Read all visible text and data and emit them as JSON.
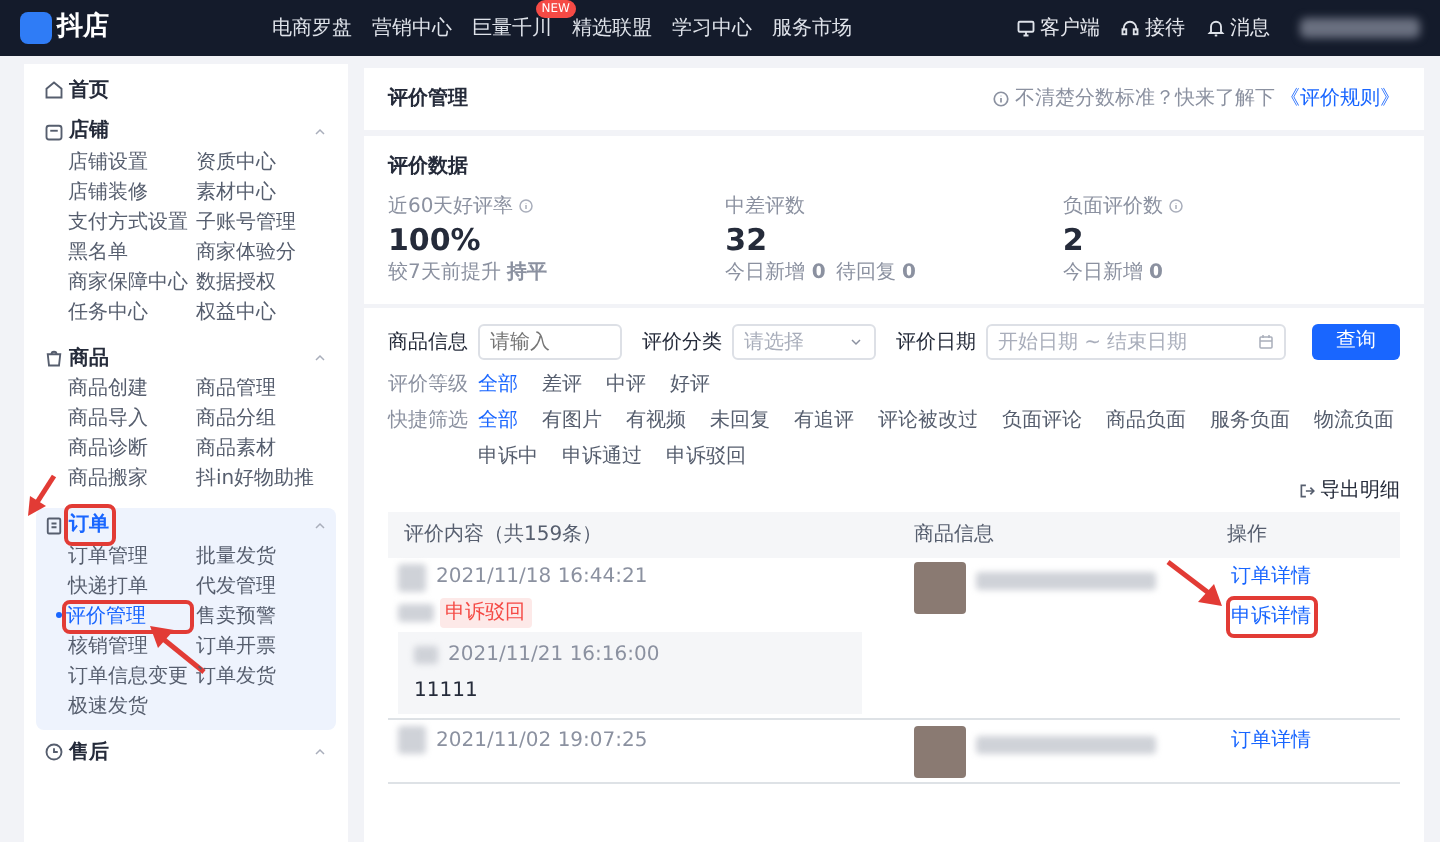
{
  "topbar": {
    "logo": "抖店",
    "nav": [
      {
        "label": "电商罗盘"
      },
      {
        "label": "营销中心"
      },
      {
        "label": "巨量千川",
        "badge": "NEW"
      },
      {
        "label": "精选联盟"
      },
      {
        "label": "学习中心"
      },
      {
        "label": "服务市场"
      }
    ],
    "tools": [
      {
        "kind": "desktop",
        "label": "客户端"
      },
      {
        "kind": "headset",
        "label": "接待"
      },
      {
        "kind": "bell",
        "label": "消息"
      }
    ]
  },
  "sidebar": {
    "items": [
      {
        "kind": "home",
        "label": "首页"
      },
      {
        "kind": "shop",
        "label": "店铺",
        "expanded": true,
        "children": [
          {
            "label": "店铺设置",
            "selected": false
          },
          {
            "label": "资质中心",
            "selected": false
          },
          {
            "label": "店铺装修",
            "selected": false
          },
          {
            "label": "素材中心",
            "selected": false
          },
          {
            "label": "支付方式设置",
            "selected": false
          },
          {
            "label": "子账号管理",
            "selected": false
          },
          {
            "label": "黑名单",
            "selected": false
          },
          {
            "label": "商家体验分",
            "selected": false
          },
          {
            "label": "商家保障中心",
            "selected": false
          },
          {
            "label": "数据授权",
            "selected": false
          },
          {
            "label": "任务中心",
            "selected": false
          },
          {
            "label": "权益中心",
            "selected": false
          }
        ]
      },
      {
        "kind": "goods",
        "label": "商品",
        "expanded": true,
        "children": [
          {
            "label": "商品创建",
            "selected": false
          },
          {
            "label": "商品管理",
            "selected": false
          },
          {
            "label": "商品导入",
            "selected": false
          },
          {
            "label": "商品分组",
            "selected": false
          },
          {
            "label": "商品诊断",
            "selected": false
          },
          {
            "label": "商品素材",
            "selected": false
          },
          {
            "label": "商品搬家",
            "selected": false
          },
          {
            "label": "抖in好物助推",
            "selected": false
          }
        ]
      },
      {
        "kind": "order",
        "label": "订单",
        "expanded": true,
        "annotated": true,
        "children": [
          {
            "label": "订单管理",
            "selected": false
          },
          {
            "label": "批量发货",
            "selected": false
          },
          {
            "label": "快递打单",
            "selected": false
          },
          {
            "label": "代发管理",
            "selected": false
          },
          {
            "label": "评价管理",
            "selected": true,
            "annotated": true
          },
          {
            "label": "售卖预警",
            "selected": false
          },
          {
            "label": "核销管理",
            "selected": false
          },
          {
            "label": "订单开票",
            "selected": false
          },
          {
            "label": "订单信息变更",
            "selected": false
          },
          {
            "label": "订单发货",
            "selected": false
          },
          {
            "label": "极速发货",
            "selected": false
          }
        ]
      },
      {
        "kind": "aftersale",
        "label": "售后",
        "expanded": true
      }
    ]
  },
  "page_header": {
    "title": "评价管理",
    "help": "不清楚分数标准？快来了解下",
    "link": "《评价规则》"
  },
  "stats": {
    "title": "评价数据",
    "metrics": [
      {
        "label": "近60天好评率",
        "info": true,
        "value": "100%",
        "notes": [
          "较7天前提升 **持平**"
        ]
      },
      {
        "label": "中差评数",
        "info": false,
        "value": "32",
        "notes": [
          "今日新增 **0**",
          "待回复 **0**"
        ]
      },
      {
        "label": "负面评价数",
        "info": true,
        "value": "2",
        "notes": [
          "今日新增 **0**"
        ]
      }
    ]
  },
  "filters": {
    "fields": [
      {
        "kind": "input",
        "label": "商品信息",
        "placeholder": "请输入"
      },
      {
        "kind": "select",
        "label": "评价分类",
        "placeholder": "请选择"
      },
      {
        "kind": "daterange",
        "label": "评价日期",
        "start_placeholder": "开始日期",
        "separator": "~",
        "end_placeholder": "结束日期"
      }
    ],
    "submit": "查询",
    "groups": [
      {
        "label": "评价等级",
        "options": [
          {
            "label": "全部",
            "selected": true
          },
          {
            "label": "差评",
            "selected": false
          },
          {
            "label": "中评",
            "selected": false
          },
          {
            "label": "好评",
            "selected": false
          }
        ]
      },
      {
        "label": "快捷筛选",
        "options": [
          {
            "label": "全部",
            "selected": true
          },
          {
            "label": "有图片",
            "selected": false
          },
          {
            "label": "有视频",
            "selected": false
          },
          {
            "label": "未回复",
            "selected": false
          },
          {
            "label": "有追评",
            "selected": false
          },
          {
            "label": "评论被改过",
            "selected": false
          },
          {
            "label": "负面评论",
            "selected": false
          },
          {
            "label": "商品负面",
            "selected": false
          },
          {
            "label": "服务负面",
            "selected": false
          },
          {
            "label": "物流负面",
            "selected": false
          },
          {
            "label": "申诉中",
            "selected": false
          },
          {
            "label": "申诉通过",
            "selected": false
          },
          {
            "label": "申诉驳回",
            "selected": false
          }
        ]
      }
    ],
    "export": "导出明细"
  },
  "table": {
    "columns": [
      "评价内容（共159条）",
      "商品信息",
      "操作"
    ],
    "rows": [
      {
        "time": "2021/11/18 16:44:21",
        "tag": "申诉驳回",
        "reply": {
          "time": "2021/11/21 16:16:00",
          "text": "11111"
        },
        "actions": [
          {
            "label": "订单详情"
          },
          {
            "label": "申诉详情",
            "annotated": true
          }
        ]
      },
      {
        "time": "2021/11/02 19:07:25",
        "actions": [
          {
            "label": "订单详情"
          }
        ]
      }
    ]
  }
}
